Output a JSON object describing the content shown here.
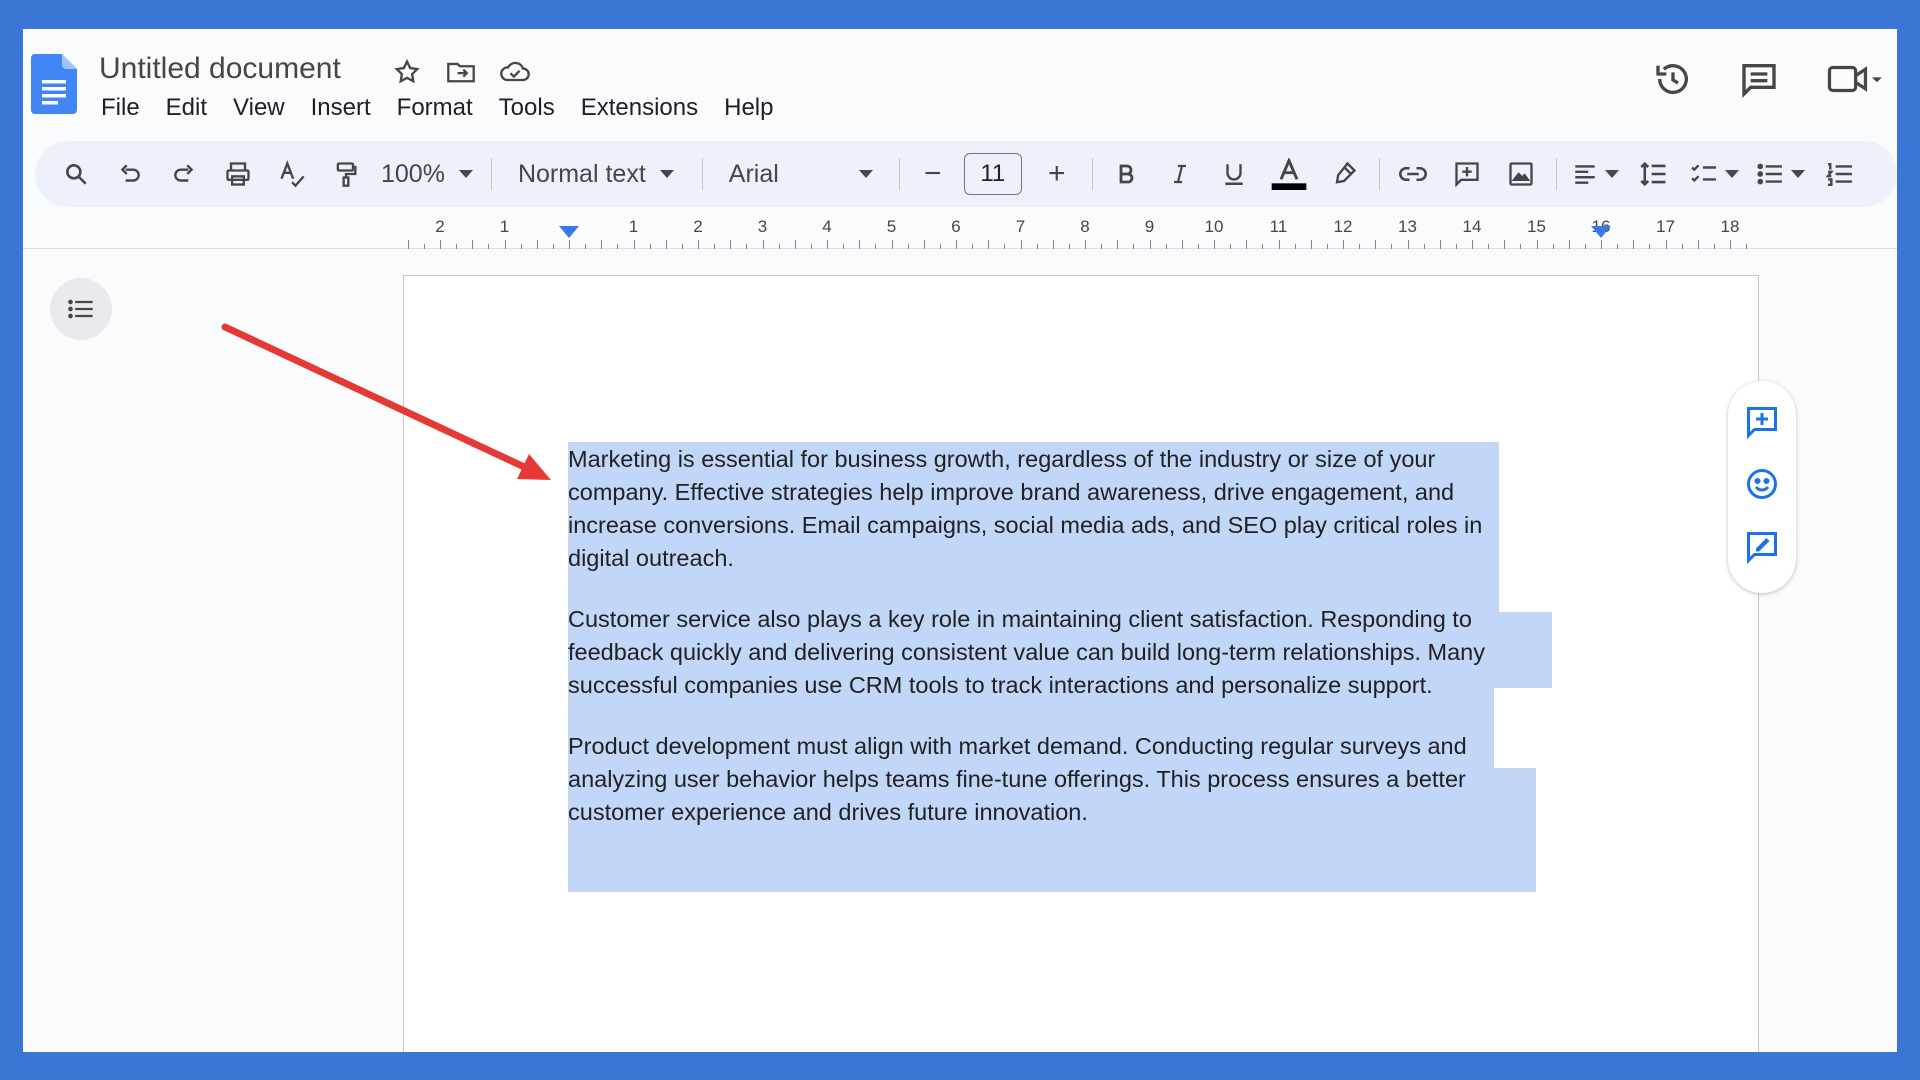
{
  "app": {
    "title": "Untitled document",
    "brand_color": "#4285f4",
    "frame_color": "#3a76d6",
    "selection_color": "#c2d7f7",
    "annotation_arrow_color": "#e53935"
  },
  "menu": [
    "File",
    "Edit",
    "View",
    "Insert",
    "Format",
    "Tools",
    "Extensions",
    "Help"
  ],
  "title_icons": [
    "star-icon",
    "move-folder-icon",
    "cloud-saved-icon"
  ],
  "top_right_icons": [
    "version-history-icon",
    "comments-icon",
    "meet-icon"
  ],
  "toolbar": {
    "zoom": "100%",
    "style": "Normal text",
    "font": "Arial",
    "font_size": "11",
    "minus": "−",
    "plus": "+"
  },
  "ruler": {
    "labels": [
      "2",
      "1",
      "1",
      "2",
      "3",
      "4",
      "5",
      "6",
      "7",
      "8",
      "9",
      "10",
      "11",
      "12",
      "13",
      "14",
      "15",
      "16",
      "17",
      "18"
    ]
  },
  "document": {
    "paragraphs": [
      {
        "lines": [
          "Marketing is essential for business growth, regardless of the industry or size of your",
          "company. Effective strategies help improve brand awareness, drive engagement, and",
          "increase conversions. Email campaigns, social media ads, and SEO play critical roles in",
          "digital outreach."
        ]
      },
      {
        "lines": [
          "Customer service also plays a key role in maintaining client satisfaction. Responding to",
          "feedback quickly and delivering consistent value can build long-term relationships. Many",
          "successful companies use CRM tools to track interactions and personalize support."
        ]
      },
      {
        "lines": [
          "Product development must align with market demand. Conducting regular surveys and",
          "analyzing user behavior helps teams fine-tune offerings. This process ensures a better",
          "customer experience and drives future innovation."
        ]
      }
    ]
  },
  "side_panel_icons": [
    "add-comment-icon",
    "emoji-reaction-icon",
    "suggest-edits-icon"
  ]
}
